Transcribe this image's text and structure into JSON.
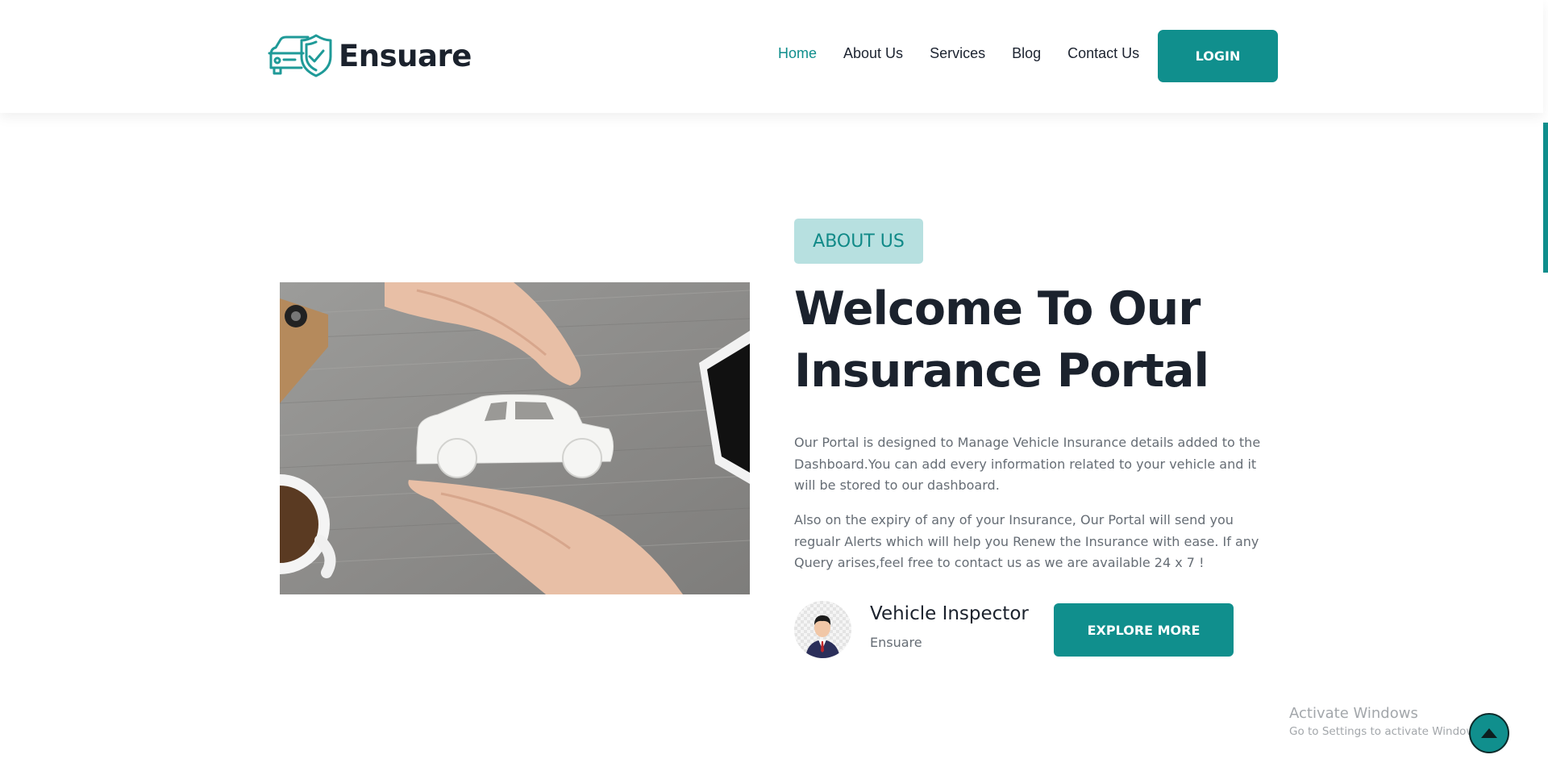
{
  "brand": {
    "name": "Ensuare",
    "logo_icon": "car-shield-icon",
    "accent_color": "#108f8d"
  },
  "nav": {
    "items": [
      {
        "label": "Home",
        "active": true
      },
      {
        "label": "About Us",
        "active": false
      },
      {
        "label": "Services",
        "active": false
      },
      {
        "label": "Blog",
        "active": false
      },
      {
        "label": "Contact Us",
        "active": false
      }
    ],
    "login_label": "LOGIN"
  },
  "about": {
    "badge": "ABOUT US",
    "headline_line1": "Welcome To Our",
    "headline_line2": "Insurance Portal",
    "paragraph1": "Our Portal is designed to Manage Vehicle Insurance details added to the Dashboard.You can add every information related to your vehicle and it will be stored to our dashboard.",
    "paragraph2": "Also on the expiry of any of your Insurance, Our Portal will send you regualr Alerts which will help you Renew the Insurance with ease. If any Query arises,feel free to contact us as we are available 24 x 7 !",
    "inspector_title": "Vehicle Inspector",
    "inspector_subtitle": "Ensuare",
    "explore_label": "EXPLORE MORE"
  },
  "windows_watermark": {
    "title": "Activate Windows",
    "subtitle": "Go to Settings to activate Windows."
  },
  "back_to_top_icon": "arrow-up-icon"
}
